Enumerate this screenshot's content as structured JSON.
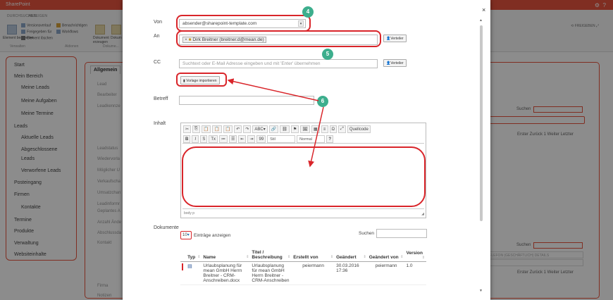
{
  "app": {
    "title": "SharePoint"
  },
  "ribbon": {
    "tabs": [
      "DURCHSUCHEN",
      "ANZEIGEN"
    ],
    "items": [
      "Versionsverlauf",
      "Freigegeben für",
      "Element löschen",
      "Benachrichtigen",
      "Workflows",
      "Dokument erzeugen",
      "Dokument hochladen"
    ],
    "big_items": [
      "Element bearbeiten"
    ],
    "groups": [
      "Verwalten",
      "Aktionen",
      "Dokume..."
    ],
    "share": "FREIGEBEN"
  },
  "nav": {
    "items": [
      {
        "label": "Start",
        "level": 0
      },
      {
        "label": "Mein Bereich",
        "level": 0
      },
      {
        "label": "Meine Leads",
        "level": 1
      },
      {
        "label": "Meine Aufgaben",
        "level": 1
      },
      {
        "label": "Meine Termine",
        "level": 1
      },
      {
        "label": "Leads",
        "level": 0
      },
      {
        "label": "Aktuelle Leads",
        "level": 1
      },
      {
        "label": "Abgeschlossene",
        "level": 1
      },
      {
        "label": "Leads",
        "level": 1
      },
      {
        "label": "Verworfene Leads",
        "level": 1
      },
      {
        "label": "Posteingang",
        "level": 0
      },
      {
        "label": "Firmen",
        "level": 0
      },
      {
        "label": "Kontakte",
        "level": 1
      },
      {
        "label": "Termine",
        "level": 0
      },
      {
        "label": "Produkte",
        "level": 0
      },
      {
        "label": "Verwaltung",
        "level": 0
      },
      {
        "label": "Websiteinhalte",
        "level": 0
      }
    ]
  },
  "background": {
    "tab": "Allgemein",
    "field_labels": [
      "Lead",
      "Bearbeiter",
      "Leadkennze",
      "Leadstatus",
      "Wiedervorla",
      "Möglicher U",
      "Verkaufscha",
      "Umsatzchan",
      "Leadinformr",
      "Geplantes A",
      "Anzahl Ände",
      "Abschlussda",
      "Kontakt",
      "Firma",
      "Notizen"
    ],
    "search_label": "Suchen",
    "pager": "Erster Zurück 1 Weiter Letzter",
    "col_headers": "TELEFON (GESCHÄFTLICH)    DETAILS"
  },
  "modal": {
    "close": "×",
    "von_label": "Von",
    "von_value": "absender@sharepoint-template.com",
    "an_label": "An",
    "an_chip": "Dirk Breitner (breitner.d@mean.de)",
    "verteiler_label": "Verteiler",
    "cc_label": "CC",
    "cc_placeholder": "Suchtext oder E-Mail Adresse eingeben und mit 'Enter' übernehmen",
    "template_button": "Vorlage importieren",
    "betreff_label": "Betreff",
    "betreff_value": "",
    "inhalt_label": "Inhalt",
    "editor": {
      "row1": [
        "✂",
        "⎘",
        "📋",
        "📋",
        "📋",
        "↶",
        "↷",
        "ABC▾",
        "🔗",
        "⛓",
        "⚑",
        "🖼",
        "▦",
        "≡",
        "Ω",
        "⤢",
        "Quellcode"
      ],
      "row2": [
        "B",
        "I",
        "S",
        "Tx",
        "≔",
        "☰",
        "⇤",
        "⇥",
        "99"
      ],
      "style_dd": "Stil",
      "format_dd": "Normal",
      "help": "?",
      "status": "body  p"
    },
    "dokumente_label": "Dokumente",
    "entries_count": "10",
    "entries_label": "Einträge anzeigen",
    "search_label": "Suchen",
    "table": {
      "headers": [
        "Typ",
        "Name",
        "Titel / Beschreibung",
        "Erstellt von",
        "Geändert",
        "Geändert von",
        "Version"
      ],
      "rows": [
        {
          "type_icon": "word-doc-icon",
          "name": "Urlaubsplanung für mean GmbH Herrn Breitner - CRM-Anschreiben.docx",
          "title": "Urlaubsplanung für mean GmbH Herrn Breitner - CRM-Anschreiben",
          "created_by": "peiermann",
          "modified": "30.03.2016 17:36",
          "modified_by": "peiermann",
          "version": "1.0"
        }
      ]
    }
  },
  "annotations": [
    "4",
    "5",
    "6"
  ],
  "colors": {
    "brand": "#e9553f",
    "highlight": "#d9252a",
    "badge": "#3dae8d",
    "link": "#2a7ab9"
  }
}
